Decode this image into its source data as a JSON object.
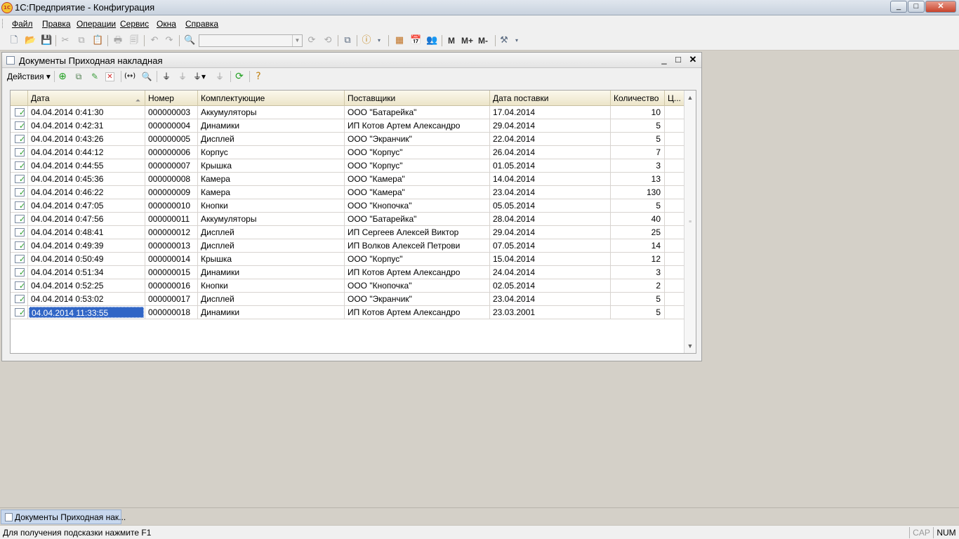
{
  "app": {
    "title": "1С:Предприятие - Конфигурация",
    "logo_text": "1С",
    "btn_min": "_",
    "btn_max": "□",
    "btn_close": "✕"
  },
  "menu": [
    "Файл",
    "Правка",
    "Операции",
    "Сервис",
    "Окна",
    "Справка"
  ],
  "toolbar": {
    "search_value": "",
    "memory_labels": [
      "M",
      "M+",
      "M-"
    ]
  },
  "doc": {
    "title": "Документы Приходная накладная",
    "actions_label": "Действия ▾",
    "ctl_min": "_",
    "ctl_max": "□",
    "ctl_close": "✕"
  },
  "grid": {
    "columns": [
      "Дата",
      "Номер",
      "Комплектующие",
      "Поставщики",
      "Дата поставки",
      "Количество",
      "Ц..."
    ],
    "sort_icon": "⏶",
    "rows": [
      {
        "date": "04.04.2014 0:41:30",
        "num": "000000003",
        "part": "Аккумуляторы",
        "supplier": "ООО \"Батарейка\"",
        "delivery": "17.04.2014",
        "qty": "10"
      },
      {
        "date": "04.04.2014 0:42:31",
        "num": "000000004",
        "part": "Динамики",
        "supplier": "ИП Котов Артем Александро",
        "delivery": "29.04.2014",
        "qty": "5"
      },
      {
        "date": "04.04.2014 0:43:26",
        "num": "000000005",
        "part": "Дисплей",
        "supplier": "ООО \"Экранчик\"",
        "delivery": "22.04.2014",
        "qty": "5"
      },
      {
        "date": "04.04.2014 0:44:12",
        "num": "000000006",
        "part": "Корпус",
        "supplier": "ООО \"Корпус\"",
        "delivery": "26.04.2014",
        "qty": "7"
      },
      {
        "date": "04.04.2014 0:44:55",
        "num": "000000007",
        "part": "Крышка",
        "supplier": "ООО \"Корпус\"",
        "delivery": "01.05.2014",
        "qty": "3"
      },
      {
        "date": "04.04.2014 0:45:36",
        "num": "000000008",
        "part": "Камера",
        "supplier": "ООО \"Камера\"",
        "delivery": "14.04.2014",
        "qty": "13"
      },
      {
        "date": "04.04.2014 0:46:22",
        "num": "000000009",
        "part": "Камера",
        "supplier": "ООО \"Камера\"",
        "delivery": "23.04.2014",
        "qty": "130"
      },
      {
        "date": "04.04.2014 0:47:05",
        "num": "000000010",
        "part": "Кнопки",
        "supplier": "ООО \"Кнопочка\"",
        "delivery": "05.05.2014",
        "qty": "5"
      },
      {
        "date": "04.04.2014 0:47:56",
        "num": "000000011",
        "part": "Аккумуляторы",
        "supplier": "ООО \"Батарейка\"",
        "delivery": "28.04.2014",
        "qty": "40"
      },
      {
        "date": "04.04.2014 0:48:41",
        "num": "000000012",
        "part": "Дисплей",
        "supplier": "ИП Сергеев Алексей Виктор",
        "delivery": "29.04.2014",
        "qty": "25"
      },
      {
        "date": "04.04.2014 0:49:39",
        "num": "000000013",
        "part": "Дисплей",
        "supplier": "ИП Волков Алексей Петрови",
        "delivery": "07.05.2014",
        "qty": "14"
      },
      {
        "date": "04.04.2014 0:50:49",
        "num": "000000014",
        "part": "Крышка",
        "supplier": "ООО \"Корпус\"",
        "delivery": "15.04.2014",
        "qty": "12"
      },
      {
        "date": "04.04.2014 0:51:34",
        "num": "000000015",
        "part": "Динамики",
        "supplier": "ИП Котов Артем Александро",
        "delivery": "24.04.2014",
        "qty": "3"
      },
      {
        "date": "04.04.2014 0:52:25",
        "num": "000000016",
        "part": "Кнопки",
        "supplier": "ООО \"Кнопочка\"",
        "delivery": "02.05.2014",
        "qty": "2"
      },
      {
        "date": "04.04.2014 0:53:02",
        "num": "000000017",
        "part": "Дисплей",
        "supplier": "ООО \"Экранчик\"",
        "delivery": "23.04.2014",
        "qty": "5"
      },
      {
        "date": "04.04.2014 11:33:55",
        "num": "000000018",
        "part": "Динамики",
        "supplier": "ИП Котов Артем Александро",
        "delivery": "23.03.2001",
        "qty": "5",
        "selected": true
      }
    ]
  },
  "taskbar": {
    "item": "Документы Приходная нак..."
  },
  "status": {
    "hint": "Для получения подсказки нажмите F1",
    "cap": "CAP",
    "num": "NUM"
  },
  "colors": {
    "selection": "#3166c6",
    "header_bg": "#ece5c9",
    "workspace": "#d4d0c8"
  }
}
